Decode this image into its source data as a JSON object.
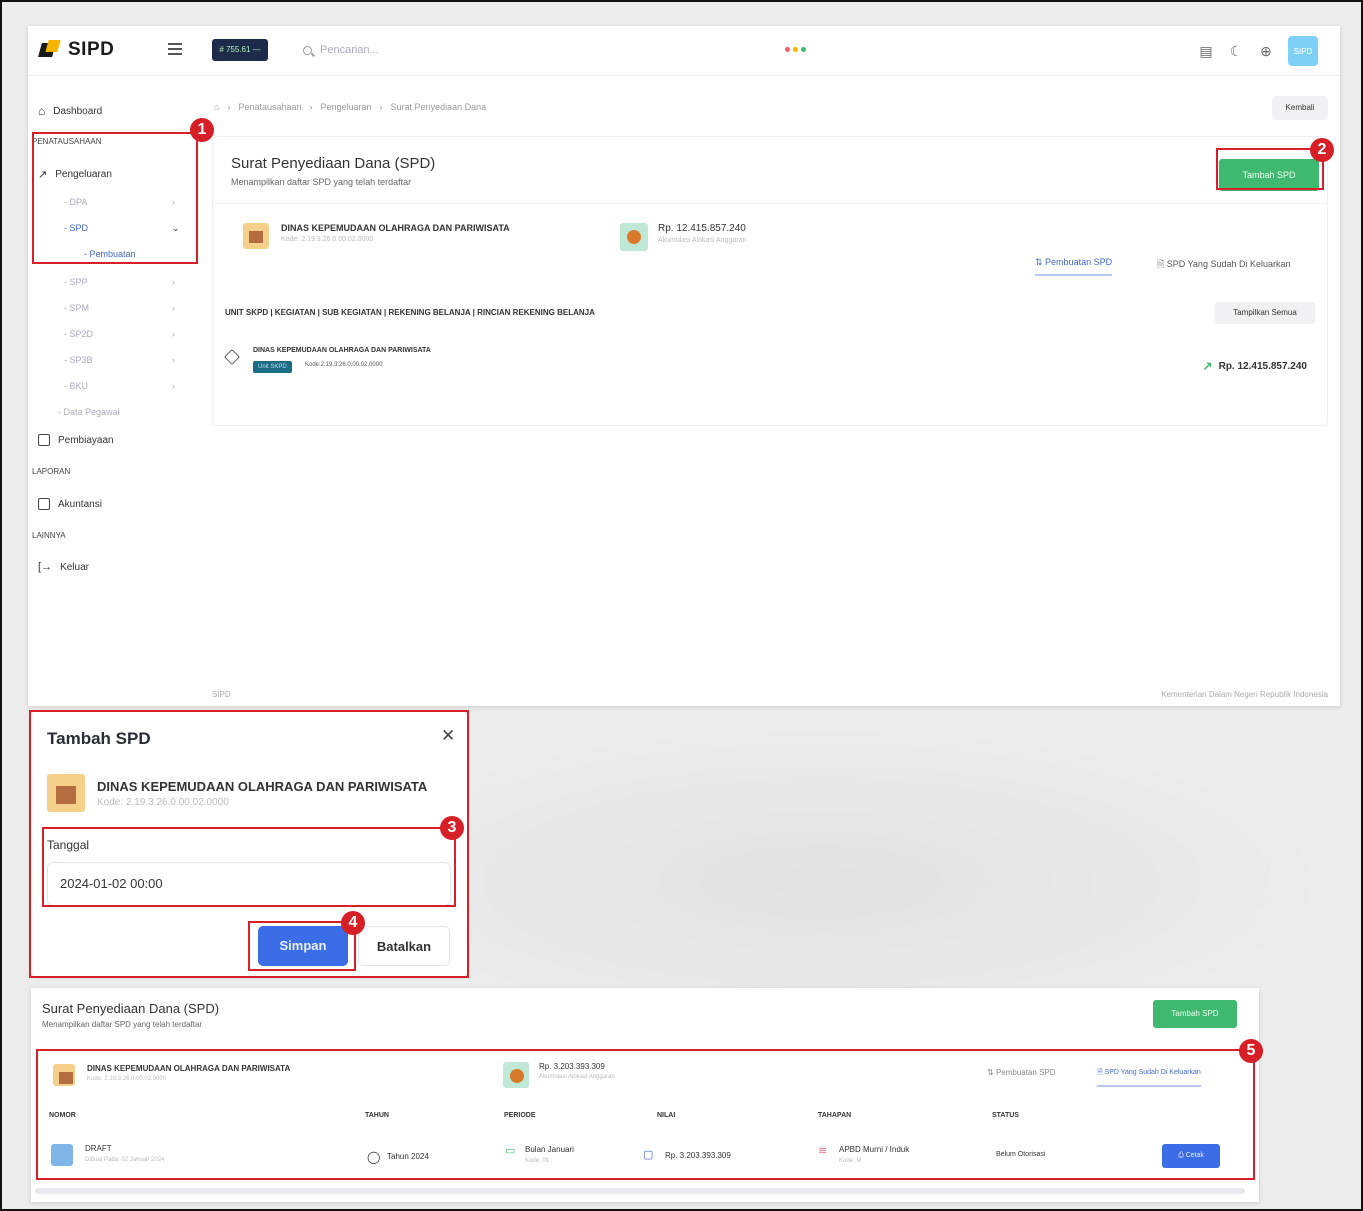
{
  "app": {
    "logo": "SIPD",
    "topbar_badge": "# 755.61 —",
    "search_placeholder": "Pencarian...",
    "avatar_text": "SIPD"
  },
  "sidebar": {
    "dashboard": "Dashboard",
    "section_penatausahaan": "PENATAUSAHAAN",
    "pengeluaran": "Pengeluaran",
    "sub": [
      {
        "label": "DPA"
      },
      {
        "label": "SPD"
      },
      {
        "label": "Pembuatan"
      },
      {
        "label": "SPP"
      },
      {
        "label": "SPM"
      },
      {
        "label": "SP2D"
      },
      {
        "label": "SP3B"
      },
      {
        "label": "BKU"
      },
      {
        "label": "Data Pegawai"
      }
    ],
    "pembiayaan": "Pembiayaan",
    "section_laporan": "LAPORAN",
    "akuntansi": "Akuntansi",
    "section_lainnya": "LAINNYA",
    "keluar": "Keluar"
  },
  "breadcrumb": [
    "Penatausahaan",
    "Pengeluaran",
    "Surat Penyediaan Dana"
  ],
  "kembali": "Kembali",
  "main": {
    "title": "Surat Penyediaan Dana (SPD)",
    "subtitle": "Menampilkan daftar SPD yang telah terdaftar",
    "tambah": "Tambah SPD",
    "org_name": "DINAS KEPEMUDAAN OLAHRAGA DAN PARIWISATA",
    "org_code": "Kode: 2.19.3.26.0.00.02.0000",
    "amount": "Rp. 12.415.857.240",
    "amount_sub": "Akumulasi Alokasi Anggaran",
    "tab_pembuatan": "Pembuatan SPD",
    "tab_dikeluarkan": "SPD Yang Sudah Di Keluarkan",
    "unit_header": "UNIT SKPD | KEGIATAN | SUB KEGIATAN | REKENING BELANJA | RINCIAN REKENING BELANJA",
    "tampilkan": "Tampilkan Semua",
    "unit_name": "DINAS KEPEMUDAAN OLAHRAGA DAN PARIWISATA",
    "unit_badge": "Unit SKPD",
    "unit_code": "Kode:2.19.3.26.0.00.02.0000",
    "unit_total": "Rp. 12.415.857.240",
    "footer_left": "SIPD",
    "footer_right": "Kementerian Dalam Negeri Republik Indonesia"
  },
  "modal": {
    "title": "Tambah SPD",
    "org_name": "DINAS KEPEMUDAAN OLAHRAGA DAN PARIWISATA",
    "org_code": "Kode: 2.19.3.26.0.00.02.0000",
    "label_tanggal": "Tanggal",
    "tanggal_value": "2024-01-02 00:00",
    "simpan": "Simpan",
    "batalkan": "Batalkan"
  },
  "panel": {
    "title": "Surat Penyediaan Dana (SPD)",
    "subtitle": "Menampilkan daftar SPD yang telah terdaftar",
    "tambah": "Tambah SPD",
    "org_name": "DINAS KEPEMUDAAN OLAHRAGA DAN PARIWISATA",
    "org_code": "Kode: 2.19.3.26.0.00.02.0000",
    "amount": "Rp. 3.203.393.309",
    "amount_sub": "Akumulasi Alokasi Anggaran",
    "tab_pembuatan": "Pembuatan SPD",
    "tab_dikeluarkan": "SPD Yang Sudah Di Keluarkan",
    "headers": [
      "NOMOR",
      "TAHUN",
      "PERIODE",
      "NILAI",
      "TAHAPAN",
      "STATUS"
    ],
    "row": {
      "nomor": "DRAFT",
      "nomor_sub": "Dibuat Pada: 02 Januari 2024",
      "tahun": "Tahun 2024",
      "periode": "Bulan Januari",
      "periode_sub": "Kode: 01",
      "nilai": "Rp. 3.203.393.309",
      "tahapan": "APBD Murni / Induk",
      "tahapan_sub": "Kode: M",
      "status": "Belum Otorisasi",
      "cetak": "Cetak"
    }
  },
  "annotations": [
    "1",
    "2",
    "3",
    "4",
    "5"
  ],
  "colors": {
    "accent_red": "#d61f26",
    "primary_blue": "#3b6de6",
    "green": "#3fb96f"
  }
}
